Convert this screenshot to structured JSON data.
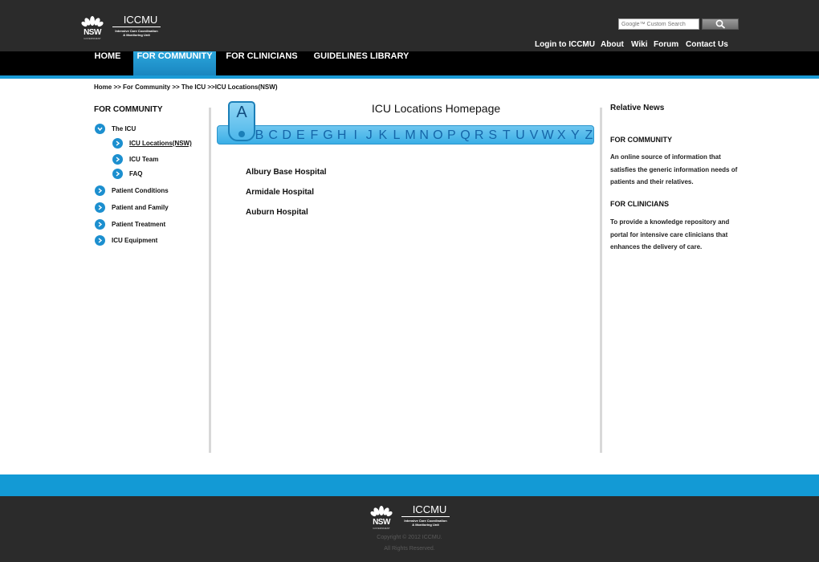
{
  "header": {
    "logo": {
      "nsw": "NSW",
      "government": "GOVERNMENT",
      "name": "ICCMU",
      "subtitle_line1": "Intensive Care Coordination",
      "subtitle_line2": "& Monitoring Unit"
    },
    "search": {
      "placeholder": "Google™ Custom Search"
    },
    "links": [
      "Login to ICCMU",
      "About",
      "Wiki",
      "Forum",
      "Contact Us"
    ]
  },
  "nav": {
    "items": [
      {
        "label": "HOME",
        "active": false
      },
      {
        "label": "FOR COMMUNITY",
        "active": true
      },
      {
        "label": "FOR CLINICIANS",
        "active": false
      },
      {
        "label": "GUIDELINES LIBRARY",
        "active": false
      }
    ]
  },
  "breadcrumb": "Home >> For Community >> The ICU >>ICU Locations(NSW)",
  "sidebar": {
    "title": "FOR COMMUNITY",
    "items": [
      {
        "label": "The ICU",
        "expanded": true
      },
      {
        "label": "ICU Locations(NSW)",
        "current": true
      },
      {
        "label": "ICU Team"
      },
      {
        "label": "FAQ"
      },
      {
        "label": "Patient Conditions"
      },
      {
        "label": "Patient and Family"
      },
      {
        "label": "Patient Treatment"
      },
      {
        "label": "ICU Equipment"
      }
    ]
  },
  "main": {
    "title": "ICU Locations Homepage",
    "selected_letter": "A",
    "letters": [
      "B",
      "C",
      "D",
      "E",
      "F",
      "G",
      "H",
      "I",
      "J",
      "K",
      "L",
      "M",
      "N",
      "O",
      "P",
      "Q",
      "R",
      "S",
      "T",
      "U",
      "V",
      "W",
      "X",
      "Y",
      "Z"
    ],
    "hospitals": [
      "Albury Base Hospital",
      "Armidale Hospital",
      "Auburn Hospital"
    ]
  },
  "news": {
    "title": "Relative News",
    "sections": [
      {
        "heading": "FOR COMMUNITY",
        "body": "An online source of information that satisfies the generic information needs of patients and their relatives."
      },
      {
        "heading": "FOR CLINICIANS",
        "body": "To provide a knowledge repository and portal for intensive care clinicians that enhances the delivery of care."
      }
    ]
  },
  "footer": {
    "copyright": "Copyright © 2012 ICCMU.",
    "rights": "All Rights Reserved."
  },
  "colors": {
    "accent": "#139ad5",
    "header_bg": "#2b2b2b",
    "nav_bg": "#000000",
    "tab_active": "#1a86c0"
  }
}
